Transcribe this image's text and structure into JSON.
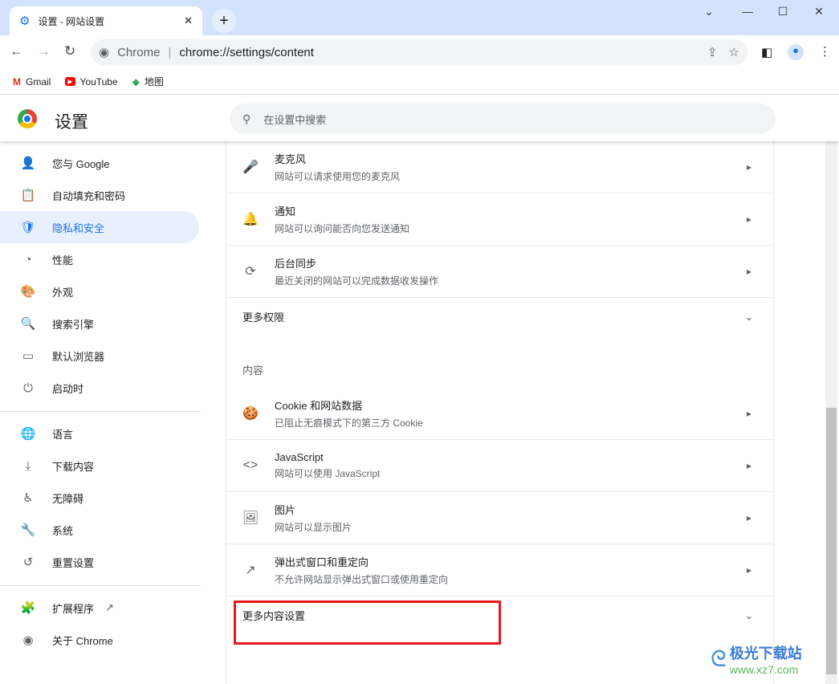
{
  "tab": {
    "title": "设置 - 网站设置",
    "close": "✕",
    "new_tab": "+"
  },
  "window": {
    "minimize": "—",
    "maximize": "☐",
    "close": "✕",
    "dropdown": "⌄"
  },
  "omnibox": {
    "origin": "Chrome",
    "url": "chrome://settings/content"
  },
  "bookmarks": [
    {
      "label": "Gmail"
    },
    {
      "label": "YouTube"
    },
    {
      "label": "地图"
    }
  ],
  "header": {
    "title": "设置",
    "search_placeholder": "在设置中搜索"
  },
  "sidebar": {
    "items": [
      {
        "label": "您与 Google",
        "icon": "👤"
      },
      {
        "label": "自动填充和密码",
        "icon": "📋"
      },
      {
        "label": "隐私和安全",
        "icon": "🛡"
      },
      {
        "label": "性能",
        "icon": "◔"
      },
      {
        "label": "外观",
        "icon": "🎨"
      },
      {
        "label": "搜索引擎",
        "icon": "🔍"
      },
      {
        "label": "默认浏览器",
        "icon": "▭"
      },
      {
        "label": "启动时",
        "icon": "⏻"
      },
      {
        "label": "语言",
        "icon": "🌐"
      },
      {
        "label": "下载内容",
        "icon": "⤓"
      },
      {
        "label": "无障碍",
        "icon": "♿"
      },
      {
        "label": "系统",
        "icon": "🔧"
      },
      {
        "label": "重置设置",
        "icon": "↺"
      },
      {
        "label": "扩展程序",
        "icon": "🧩"
      },
      {
        "label": "关于 Chrome",
        "icon": "◉"
      }
    ],
    "active_index": 2
  },
  "content": {
    "permissions": [
      {
        "title": "麦克风",
        "desc": "网站可以请求使用您的麦克风",
        "icon": "🎤"
      },
      {
        "title": "通知",
        "desc": "网站可以询问能否向您发送通知",
        "icon": "🔔"
      },
      {
        "title": "后台同步",
        "desc": "最近关闭的网站可以完成数据收发操作",
        "icon": "⟳"
      }
    ],
    "more_permissions": "更多权限",
    "section_label": "内容",
    "content_items": [
      {
        "title": "Cookie 和网站数据",
        "desc": "已阻止无痕模式下的第三方 Cookie",
        "icon": "🍪"
      },
      {
        "title": "JavaScript",
        "desc": "网站可以使用 JavaScript",
        "icon": "<>"
      },
      {
        "title": "图片",
        "desc": "网站可以显示图片",
        "icon": "🖼"
      },
      {
        "title": "弹出式窗口和重定向",
        "desc": "不允许网站显示弹出式窗口或使用重定向",
        "icon": "↗"
      }
    ],
    "more_content": "更多内容设置"
  },
  "watermark": {
    "name": "极光下载站",
    "url": "www.xz7.com"
  },
  "colors": {
    "accent": "#1a73e8",
    "highlight": "#e5191f",
    "titlebar": "#d3e3fd"
  }
}
